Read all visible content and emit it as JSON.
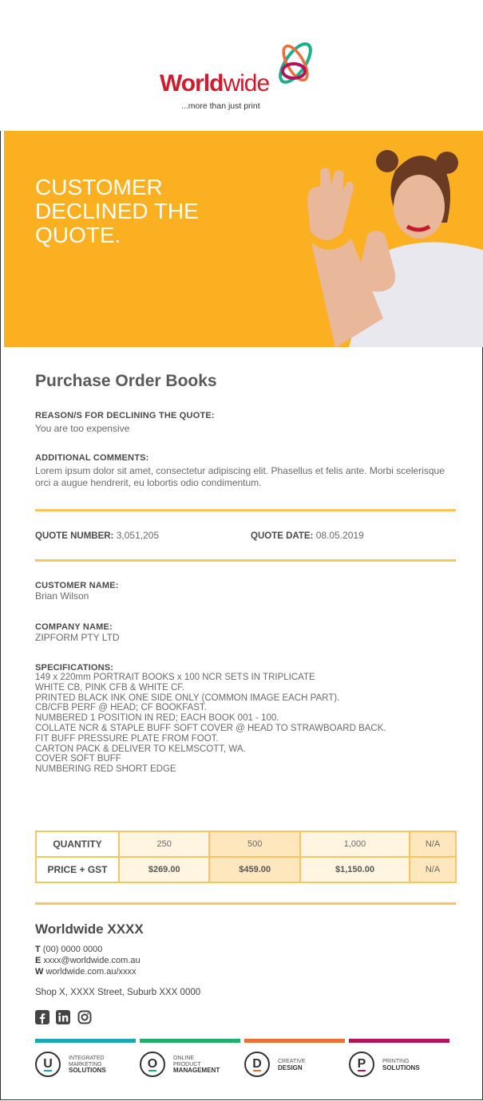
{
  "brand": {
    "word_bold": "World",
    "word_light": "wide",
    "tagline": "...more than just print"
  },
  "hero": {
    "title_lines": [
      "CUSTOMER",
      "DECLINED THE",
      "QUOTE."
    ],
    "bg_color": "#fbb022"
  },
  "order": {
    "title": "Purchase Order Books",
    "reason_label": "REASON/S FOR DECLINING THE QUOTE:",
    "reason_value": "You are too expensive",
    "comments_label": "ADDITIONAL COMMENTS:",
    "comments_value": "Lorem ipsum dolor sit amet, consectetur adipiscing elit. Phasellus et felis ante. Morbi scelerisque orci a augue hendrerit, eu lobortis odio condimentum.",
    "quote_number_label": "QUOTE NUMBER:",
    "quote_number_value": "3,051,205",
    "quote_date_label": "QUOTE DATE:",
    "quote_date_value": "08.05.2019",
    "customer_label": "CUSTOMER NAME:",
    "customer_value": "Brian Wilson",
    "company_label": "COMPANY NAME:",
    "company_value": "ZIPFORM PTY LTD",
    "specs_label": "SPECIFICATIONS:",
    "specs": [
      "149 x 220mm PORTRAIT BOOKS x 100 NCR SETS IN TRIPLICATE",
      "WHITE CB, PINK CFB & WHITE CF.",
      "PRINTED BLACK INK ONE SIDE ONLY (COMMON IMAGE EACH PART).",
      "CB/CFB PERF @ HEAD; CF BOOKFAST.",
      "NUMBERED 1 POSITION IN RED; EACH BOOK 001 - 100.",
      "COLLATE NCR & STAPLE BUFF SOFT COVER @ HEAD TO STRAWBOARD BACK.",
      "FIT BUFF PRESSURE PLATE FROM FOOT.",
      "CARTON PACK & DELIVER TO KELMSCOTT, WA.",
      "COVER SOFT BUFF",
      "NUMBERING RED SHORT EDGE"
    ]
  },
  "pricing": {
    "quantity_label": "QUANTITY",
    "price_label": "PRICE + GST",
    "quantities": [
      "250",
      "500",
      "1,000",
      "N/A"
    ],
    "prices": [
      "$269.00",
      "$459.00",
      "$1,150.00",
      "N/A"
    ]
  },
  "footer": {
    "title": "Worldwide XXXX",
    "phone_label": "T",
    "phone": "(00) 0000 0000",
    "email_label": "E",
    "email": "xxxx@worldwide.com.au",
    "web_label": "W",
    "web": "worldwide.com.au/xxxx",
    "address": "Shop X, XXXX Street, Suburb XXX 0000",
    "social_icons": [
      "facebook-icon",
      "linkedin-icon",
      "instagram-icon"
    ],
    "bar_colors": [
      "#17a9b4",
      "#1fae6b",
      "#ef6c3b",
      "#b4125a"
    ],
    "divisions": [
      {
        "letter": "U",
        "line1": "INTEGRATED",
        "line2": "MARKETING",
        "line3": "SOLUTIONS",
        "color": "#17a9b4"
      },
      {
        "letter": "O",
        "line1": "ONLINE",
        "line2": "PRODUCT",
        "line3": "MANAGEMENT",
        "color": "#1fae6b"
      },
      {
        "letter": "D",
        "line1": "CREATIVE",
        "line2": "",
        "line3": "DESIGN",
        "color": "#ef6c3b"
      },
      {
        "letter": "P",
        "line1": "PRINTING",
        "line2": "",
        "line3": "SOLUTIONS",
        "color": "#b4125a"
      }
    ]
  }
}
